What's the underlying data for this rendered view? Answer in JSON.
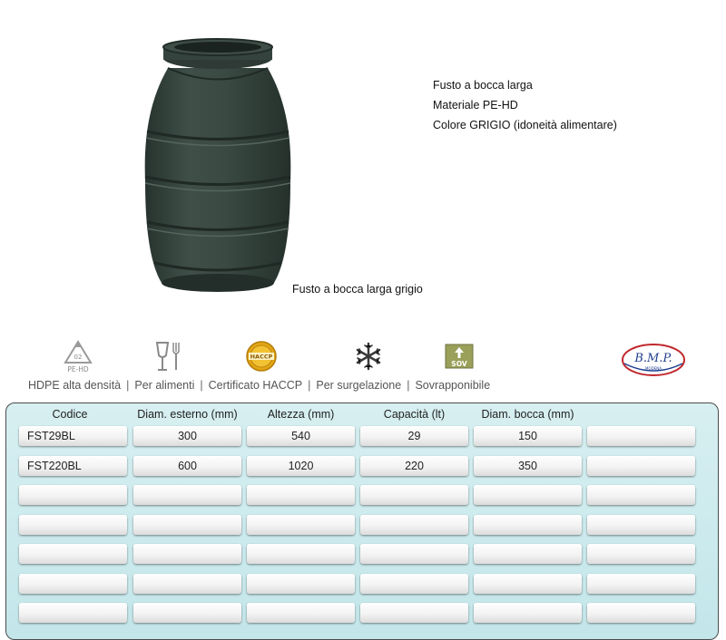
{
  "product": {
    "caption": "Fusto a bocca larga grigio",
    "body_color": "#34433d"
  },
  "description": {
    "line1": "Fusto a bocca larga",
    "line2": "Materiale PE-HD",
    "line3": "Colore GRIGIO (idoneità alimentare)"
  },
  "features": {
    "icons": {
      "recycle": "PE-HD",
      "recycle_code": "02",
      "haccp": "HACCP",
      "sov": "SOV"
    },
    "labels": [
      "HDPE alta densità",
      "Per alimenti",
      "Certificato HACCP",
      "Per surgelazione",
      "Sovrapponibile"
    ],
    "separator": "|"
  },
  "logo": {
    "text": "B.M.P.",
    "subtext": "MODENA"
  },
  "table": {
    "headers": [
      "Codice",
      "Diam. esterno (mm)",
      "Altezza (mm)",
      "Capacità (lt)",
      "Diam. bocca (mm)",
      ""
    ],
    "rows": [
      [
        "FST29BL",
        "300",
        "540",
        "29",
        "150",
        ""
      ],
      [
        "FST220BL",
        "600",
        "1020",
        "220",
        "350",
        ""
      ],
      [
        "",
        "",
        "",
        "",
        "",
        ""
      ],
      [
        "",
        "",
        "",
        "",
        "",
        ""
      ],
      [
        "",
        "",
        "",
        "",
        "",
        ""
      ],
      [
        "",
        "",
        "",
        "",
        "",
        ""
      ],
      [
        "",
        "",
        "",
        "",
        "",
        ""
      ]
    ]
  },
  "colors": {
    "table_background": "#cde9ec",
    "haccp_gold": "#e2a514",
    "logo_red": "#c0282d",
    "logo_blue": "#1f3f8f"
  }
}
